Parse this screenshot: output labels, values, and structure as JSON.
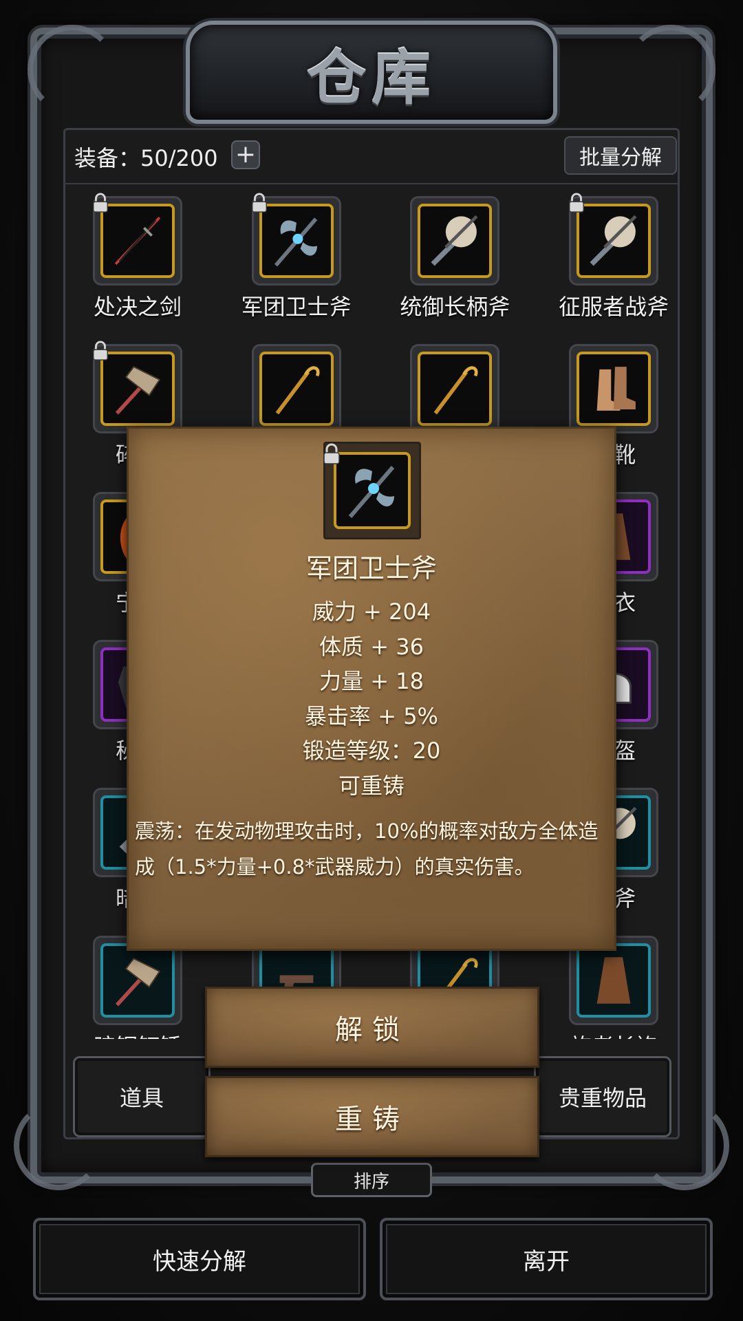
{
  "window": {
    "title": "仓库"
  },
  "header": {
    "equipment_label": "装备：50/200",
    "plus_glyph": "+",
    "batch_decompose": "批量分解"
  },
  "items": [
    {
      "name": "处决之剑",
      "rarity": "gold",
      "locked": true,
      "icon": "sword-icon"
    },
    {
      "name": "军团卫士斧",
      "rarity": "gold",
      "locked": true,
      "icon": "double-axe-icon"
    },
    {
      "name": "统御长柄斧",
      "rarity": "gold",
      "locked": false,
      "icon": "battle-axe-icon"
    },
    {
      "name": "征服者战斧",
      "rarity": "gold",
      "locked": true,
      "icon": "battle-axe-icon"
    },
    {
      "name": "碎骨",
      "rarity": "gold",
      "locked": true,
      "icon": "warhammer-icon"
    },
    {
      "name": "",
      "rarity": "gold",
      "locked": false,
      "icon": "staff-icon"
    },
    {
      "name": "",
      "rarity": "gold",
      "locked": false,
      "icon": "staff-icon"
    },
    {
      "name": "之靴",
      "rarity": "gold",
      "locked": false,
      "icon": "boots-icon"
    },
    {
      "name": "宁静",
      "rarity": "gold",
      "locked": false,
      "icon": "hair-icon"
    },
    {
      "name": "",
      "rarity": "none",
      "locked": false,
      "icon": ""
    },
    {
      "name": "",
      "rarity": "none",
      "locked": false,
      "icon": ""
    },
    {
      "name": "之衣",
      "rarity": "purple",
      "locked": false,
      "icon": "robe-icon"
    },
    {
      "name": "秘钢",
      "rarity": "purple",
      "locked": false,
      "icon": "armor-icon"
    },
    {
      "name": "",
      "rarity": "none",
      "locked": false,
      "icon": ""
    },
    {
      "name": "",
      "rarity": "none",
      "locked": false,
      "icon": ""
    },
    {
      "name": "头盔",
      "rarity": "purple",
      "locked": false,
      "icon": "helmet-icon"
    },
    {
      "name": "暗钢",
      "rarity": "teal",
      "locked": false,
      "icon": "gauntlet-icon"
    },
    {
      "name": "",
      "rarity": "none",
      "locked": false,
      "icon": ""
    },
    {
      "name": "",
      "rarity": "none",
      "locked": false,
      "icon": ""
    },
    {
      "name": "战斧",
      "rarity": "teal",
      "locked": false,
      "icon": "battle-axe-icon"
    },
    {
      "name": "暗钢钉锤",
      "rarity": "teal",
      "locked": false,
      "icon": "warhammer-icon"
    },
    {
      "name": "",
      "rarity": "teal",
      "locked": false,
      "icon": "pistol-icon"
    },
    {
      "name": "",
      "rarity": "teal",
      "locked": false,
      "icon": "staff-icon"
    },
    {
      "name": "旅者长袍",
      "rarity": "teal",
      "locked": false,
      "icon": "robe-icon"
    }
  ],
  "tabs": {
    "items": "道具",
    "valuables": "贵重物品"
  },
  "sort": "排序",
  "buttons": {
    "quick_decompose": "快速分解",
    "leave": "离开"
  },
  "popup": {
    "item_name": "军团卫士斧",
    "stats": [
      "威力 + 204",
      "体质 + 36",
      "力量 + 18",
      "暴击率 + 5%",
      "锻造等级：20",
      "可重铸"
    ],
    "description": "震荡：在发动物理攻击时，10%的概率对敌方全体造成（1.5*力量+0.8*武器威力）的真实伤害。",
    "unlock": "解锁",
    "reforge": "重铸"
  },
  "colors": {
    "gold": "#c79a1d",
    "purple": "#8e2fc0",
    "teal": "#1f8fa1",
    "parchment": "#8d6d46"
  }
}
